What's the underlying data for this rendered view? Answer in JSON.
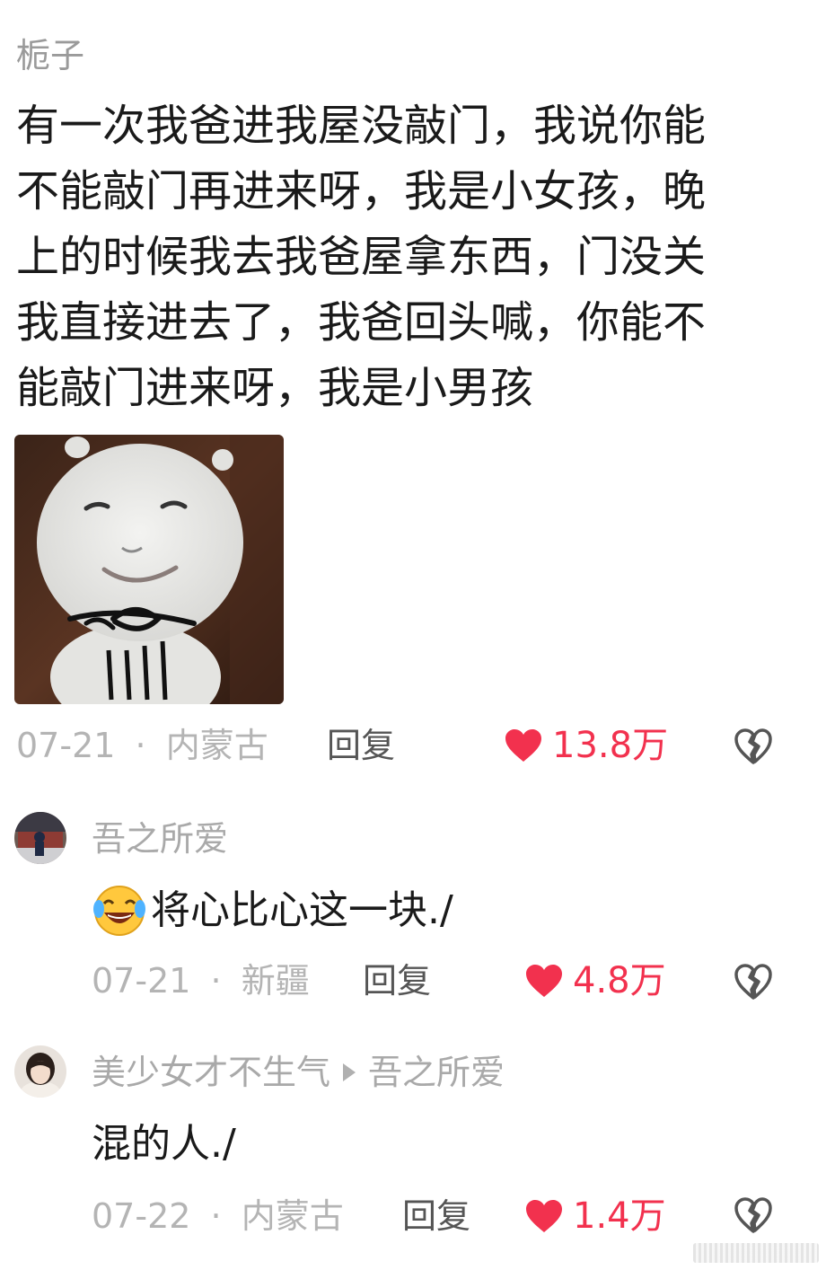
{
  "main_comment": {
    "author": "栀子",
    "text_lines": [
      "有一次我爸进我屋没敲门，我说你能",
      "不能敲门再进来呀，我是小女孩，晚",
      "上的时候我去我爸屋拿东西，门没关",
      "我直接进去了，我爸回头喊，你能不",
      "能敲门进来呀，我是小男孩"
    ],
    "image": "meme-sticker",
    "date": "07-21",
    "separator": "·",
    "location": "内蒙古",
    "reply_label": "回复",
    "likes": "13.8万"
  },
  "replies": [
    {
      "author": "吾之所爱",
      "emoji": "laughing-crying-emoji",
      "text": "将心比心这一块./",
      "date": "07-21",
      "separator": "·",
      "location": "新疆",
      "reply_label": "回复",
      "likes": "4.8万"
    },
    {
      "author": "美少女才不生气",
      "reply_to": "吾之所爱",
      "text": "混的人./",
      "date": "07-22",
      "separator": "·",
      "location": "内蒙古",
      "reply_label": "回复",
      "likes": "1.4万"
    }
  ],
  "colors": {
    "like_red": "#f2314e",
    "meta_gray": "#b4b4b4",
    "author_gray": "#9a9a9a",
    "text": "#1a1a1a"
  }
}
